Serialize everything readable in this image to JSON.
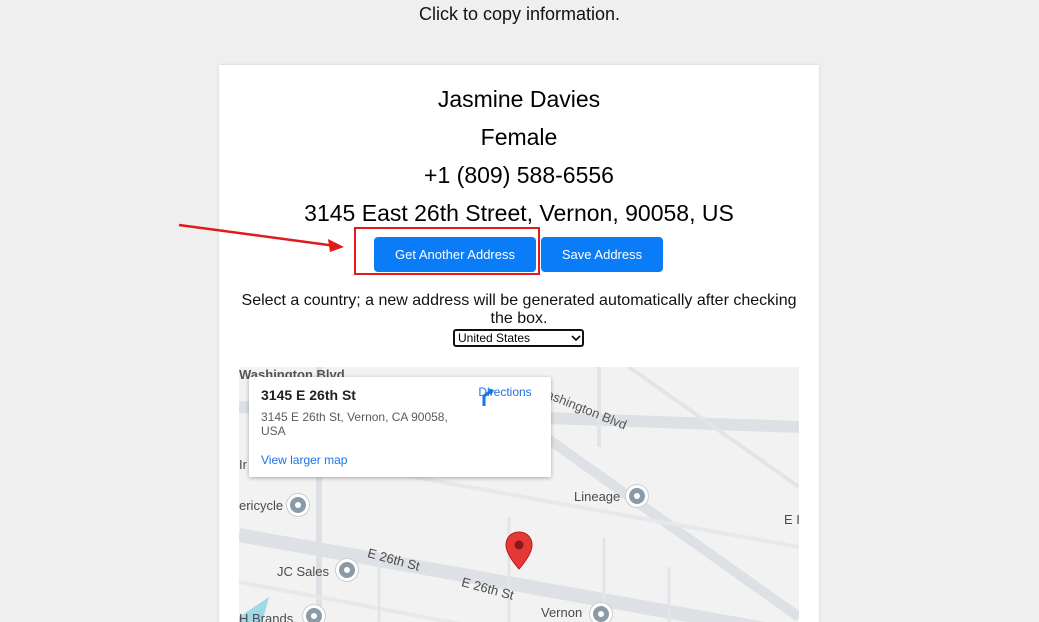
{
  "page": {
    "hint": "Click to copy information."
  },
  "person": {
    "name": "Jasmine Davies",
    "gender": "Female",
    "phone": "+1 (809) 588-6556",
    "address": "3145 East 26th Street, Vernon, 90058, US"
  },
  "actions": {
    "get_another_label": "Get Another Address",
    "save_label": "Save Address"
  },
  "country": {
    "note": "Select a country; a new address will be generated automatically after checking the box.",
    "selected": "United States"
  },
  "map": {
    "card": {
      "title": "3145 E 26th St",
      "address": "3145 E 26th St, Vernon, CA 90058, USA",
      "directions_label": "Directions",
      "larger_map_label": "View larger map"
    },
    "labels": {
      "washington_top": "Washington Blvd",
      "washington_diag": "ashington Blvd",
      "lineage": "Lineage",
      "ericycle": "ericycle",
      "jc_sales": "JC Sales",
      "e26_a": "E 26th St",
      "e26_b": "E 26th St",
      "vernon": "Vernon",
      "brands": "H Brands",
      "ir": "Ir",
      "e_right": "E I"
    }
  },
  "colors": {
    "primary_button": "#0a7cf8",
    "highlight": "#e3191a",
    "map_link": "#1a73e8",
    "pin": "#e53935"
  },
  "icons": [
    "arrow-annotation-icon",
    "directions-icon",
    "map-pin-icon",
    "chevron-down-icon",
    "poi-icon"
  ]
}
